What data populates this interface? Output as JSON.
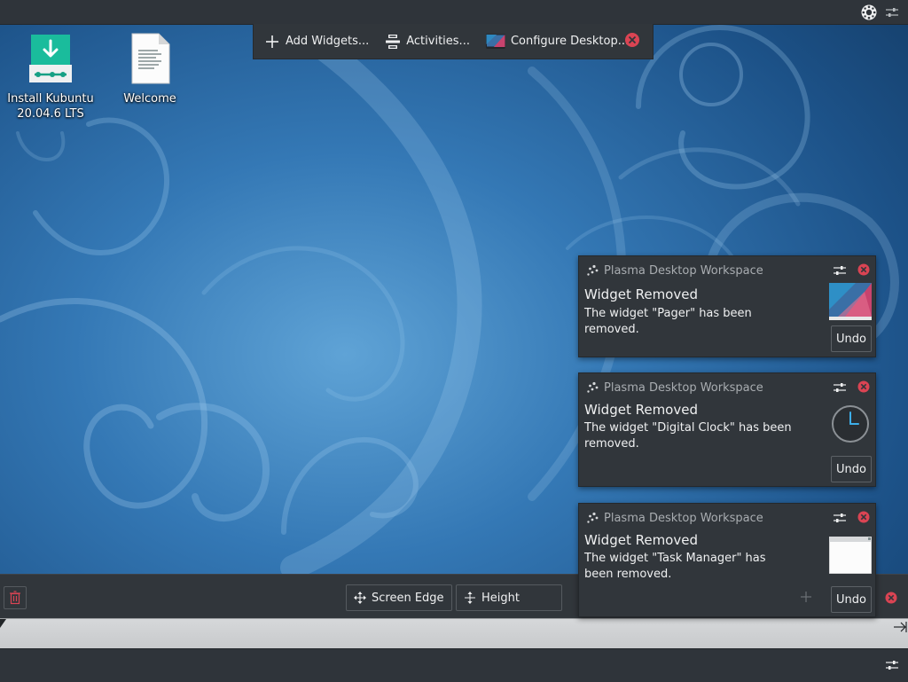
{
  "toolbox": {
    "add_widgets": "Add Widgets...",
    "activities": "Activities...",
    "configure_desktop": "Configure Desktop..."
  },
  "desktop_icons": [
    {
      "label": "Install Kubuntu 20.04.6 LTS",
      "icon": "installer-download-icon"
    },
    {
      "label": "Welcome",
      "icon": "text-document-icon"
    }
  ],
  "notifications": [
    {
      "app": "Plasma Desktop Workspace",
      "title": "Widget Removed",
      "body": "The widget \"Pager\" has been removed.",
      "undo": "Undo",
      "thumb": "pager-thumbnail"
    },
    {
      "app": "Plasma Desktop Workspace",
      "title": "Widget Removed",
      "body": "The widget \"Digital Clock\" has been removed.",
      "undo": "Undo",
      "thumb": "clock-thumbnail"
    },
    {
      "app": "Plasma Desktop Workspace",
      "title": "Widget Removed",
      "body": "The widget \"Task Manager\" has been removed.",
      "undo": "Undo",
      "thumb": "task-manager-thumbnail"
    }
  ],
  "panel_toolbar": {
    "screen_edge": "Screen Edge",
    "height": "Height"
  },
  "colors": {
    "panel_bg": "#31363b",
    "close_red": "#da4453",
    "accent_teal": "#1abc9c",
    "wallpaper_blue": "#1b4f80"
  }
}
